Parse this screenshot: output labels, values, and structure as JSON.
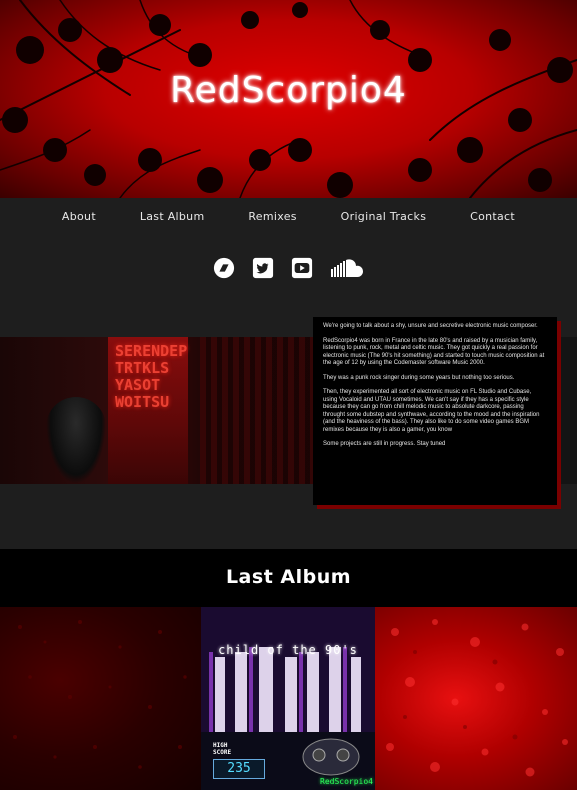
{
  "site": {
    "title": "RedScorpio4"
  },
  "nav": {
    "items": [
      {
        "label": "About"
      },
      {
        "label": "Last Album"
      },
      {
        "label": "Remixes"
      },
      {
        "label": "Original Tracks"
      },
      {
        "label": "Contact"
      }
    ]
  },
  "social": {
    "icons": [
      "bandcamp-icon",
      "twitter-icon",
      "youtube-icon",
      "soundcloud-icon"
    ]
  },
  "about": {
    "paragraphs": [
      "We're going to talk about a shy, unsure and secretive electronic music composer.",
      "RedScorpio4 was born in France in the late 80's and raised by a musician family, listening to punk, rock, metal and celtic music. They got quickly a real passion for electronic music (The 90's hit something) and started to touch music composition at the age of 12 by using the Codemaster software Music 2000.",
      "They was a punk rock singer during some years but nothing too serious.",
      "Then, they experimented all sort of electronic music on FL Studio and Cubase, using Vocaloid and UTAU sometimes. We can't say if they has a specific style because they can go from chill melodic music to absolute darkcore, passing throught some dubstep and synthwave, according to the mood and the inspiration (and the heaviness of the bass). They also like to do some video games BGM remixes because they is also a gamer, you know",
      "Some projects are still in progress. Stay tuned"
    ],
    "neon_text": "SERENDEP\nTRTKLS\nYASOT\nWOITSU"
  },
  "album": {
    "heading": "Last Album",
    "cover_title": "child of the 90's",
    "cover_score_label": "HIGH\nSCORE",
    "cover_score": "235",
    "cover_tag": "RedScorpio4"
  },
  "colors": {
    "accent_red": "#e00000",
    "dark_bg": "#1e1e1e",
    "card_shadow": "#7a0000"
  }
}
